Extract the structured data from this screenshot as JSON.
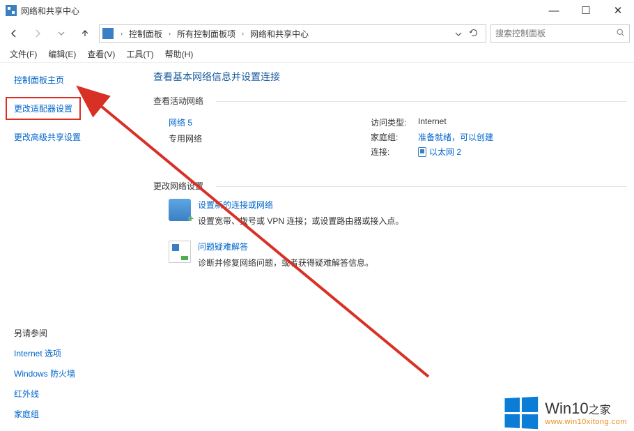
{
  "title": "网络和共享中心",
  "breadcrumb": {
    "items": [
      "控制面板",
      "所有控制面板项",
      "网络和共享中心"
    ]
  },
  "search": {
    "placeholder": "搜索控制面板"
  },
  "menu": {
    "file": "文件(F)",
    "edit": "编辑(E)",
    "view": "查看(V)",
    "tools": "工具(T)",
    "help": "帮助(H)"
  },
  "sidebar": {
    "home": "控制面板主页",
    "links": [
      "更改适配器设置",
      "更改高级共享设置"
    ]
  },
  "see_also": {
    "heading": "另请参阅",
    "items": [
      "Internet 选项",
      "Windows 防火墙",
      "红外线",
      "家庭组"
    ]
  },
  "main": {
    "heading": "查看基本网络信息并设置连接",
    "active_networks": "查看活动网络",
    "network": {
      "name": "网络 5",
      "type": "专用网络",
      "access_type_label": "访问类型:",
      "access_type": "Internet",
      "homegroup_label": "家庭组:",
      "homegroup": "准备就绪，可以创建",
      "connections_label": "连接:",
      "connections": "以太网 2"
    },
    "change_settings": "更改网络设置",
    "tasks": {
      "new_conn": {
        "title": "设置新的连接或网络",
        "desc": "设置宽带、拨号或 VPN 连接；或设置路由器或接入点。"
      },
      "troubleshoot": {
        "title": "问题疑难解答",
        "desc": "诊断并修复网络问题，或者获得疑难解答信息。"
      }
    }
  },
  "watermark": {
    "brand_main": "Win10",
    "brand_sub": "之家",
    "url": "www.win10xitong.com"
  }
}
